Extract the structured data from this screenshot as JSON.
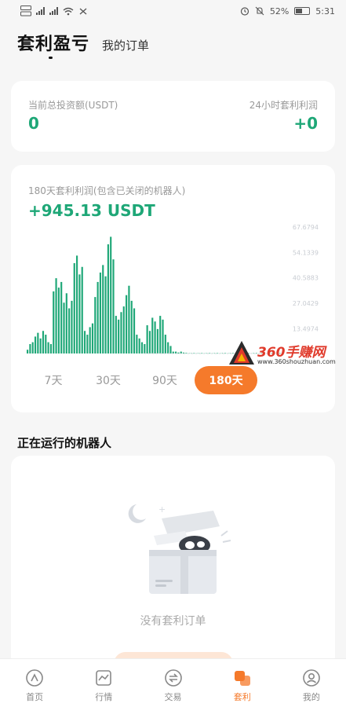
{
  "status_bar": {
    "battery": "52%",
    "time": "5:31",
    "battery_level": 0.52,
    "icons": [
      "hd-icon",
      "signal-icon",
      "signal-icon",
      "wifi-icon",
      "nfc-icon",
      "alarm-icon",
      "mute-icon",
      "battery-icon"
    ]
  },
  "header": {
    "title": "套利盈亏",
    "subtitle": "我的订单"
  },
  "invest": {
    "left_label": "当前总投资额(USDT)",
    "left_value": "0",
    "right_label": "24小时套利利润",
    "right_value": "+0"
  },
  "chart": {
    "label": "180天套利利润(包含已关闭的机器人)",
    "value": "+945.13 USDT"
  },
  "chart_data": {
    "type": "bar",
    "title": "",
    "ylim": [
      0,
      67.6
    ],
    "y_ticks": [
      "67.6794",
      "54.1339",
      "40.5883",
      "27.0429",
      "13.4974"
    ],
    "y_tick_values": [
      67.6794,
      54.1339,
      40.5883,
      27.0429,
      13.4974
    ],
    "grid": false,
    "color": "#1ea777",
    "values": [
      2,
      5,
      6,
      9,
      11,
      8,
      12,
      10,
      6,
      5,
      33,
      40,
      35,
      38,
      27,
      32,
      24,
      28,
      48,
      52,
      42,
      46,
      12,
      10,
      14,
      16,
      30,
      38,
      43,
      47,
      41,
      58,
      62,
      50,
      20,
      18,
      22,
      25,
      31,
      36,
      28,
      24,
      10,
      8,
      6,
      5,
      15,
      12,
      19,
      17,
      13,
      20,
      18,
      10,
      6,
      4,
      1,
      1,
      0.5,
      1,
      0.5,
      0.3,
      0.2,
      0.2,
      0.2,
      0.2,
      0.2,
      0.2,
      0.2,
      0.2,
      0.2,
      0.2,
      0.2,
      0.2,
      0.2,
      0.2,
      0.2,
      0.2,
      0.2,
      0.2,
      0.2,
      0.2,
      0.2,
      0.2,
      0.5,
      0.2,
      0.2,
      0.2,
      0.2,
      0.2,
      0.2,
      0.2,
      0.2,
      0.2,
      0.2,
      0.2,
      0.2,
      0.2
    ]
  },
  "ranges": [
    "7天",
    "30天",
    "90天",
    "180天"
  ],
  "active_range": "180天",
  "watermark": {
    "title": "360手赚网",
    "url": "www.360shouzhuan.com"
  },
  "section_title": "正在运行的机器人",
  "empty": {
    "text": "没有套利订单"
  },
  "tabs": [
    {
      "label": "首页",
      "icon": "home-icon"
    },
    {
      "label": "行情",
      "icon": "chart-icon"
    },
    {
      "label": "交易",
      "icon": "trade-icon"
    },
    {
      "label": "套利",
      "icon": "arbitrage-icon"
    },
    {
      "label": "我的",
      "icon": "profile-icon"
    }
  ],
  "colors": {
    "accent": "#f57a2b",
    "profit": "#1ea777"
  }
}
